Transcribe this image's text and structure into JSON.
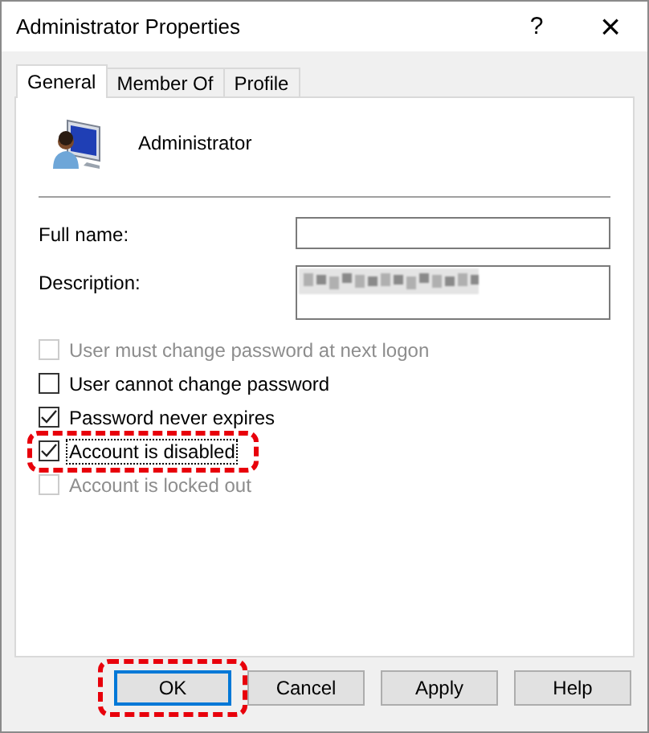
{
  "window": {
    "title": "Administrator Properties",
    "help": "?",
    "close": "×"
  },
  "tabs": [
    {
      "label": "General",
      "selected": true
    },
    {
      "label": "Member Of",
      "selected": false
    },
    {
      "label": "Profile",
      "selected": false
    }
  ],
  "user": {
    "name": "Administrator"
  },
  "fields": [
    {
      "label": "Full name:",
      "kind": "single"
    },
    {
      "label": "Description:",
      "kind": "multi",
      "redacted": true
    }
  ],
  "options": [
    {
      "label": "User must change password at next logon",
      "checked": false,
      "disabled": true,
      "focused": false,
      "highlighted": false
    },
    {
      "label": "User cannot change password",
      "checked": false,
      "disabled": false,
      "focused": false,
      "highlighted": false
    },
    {
      "label": "Password never expires",
      "checked": true,
      "disabled": false,
      "focused": false,
      "highlighted": false
    },
    {
      "label": "Account is disabled",
      "checked": true,
      "disabled": false,
      "focused": true,
      "highlighted": true
    },
    {
      "label": "Account is locked out",
      "checked": false,
      "disabled": true,
      "focused": false,
      "highlighted": false
    }
  ],
  "buttons": [
    {
      "label": "OK",
      "default": true,
      "highlighted": true
    },
    {
      "label": "Cancel",
      "default": false,
      "highlighted": false
    },
    {
      "label": "Apply",
      "default": false,
      "highlighted": false
    },
    {
      "label": "Help",
      "default": false,
      "highlighted": false
    }
  ]
}
